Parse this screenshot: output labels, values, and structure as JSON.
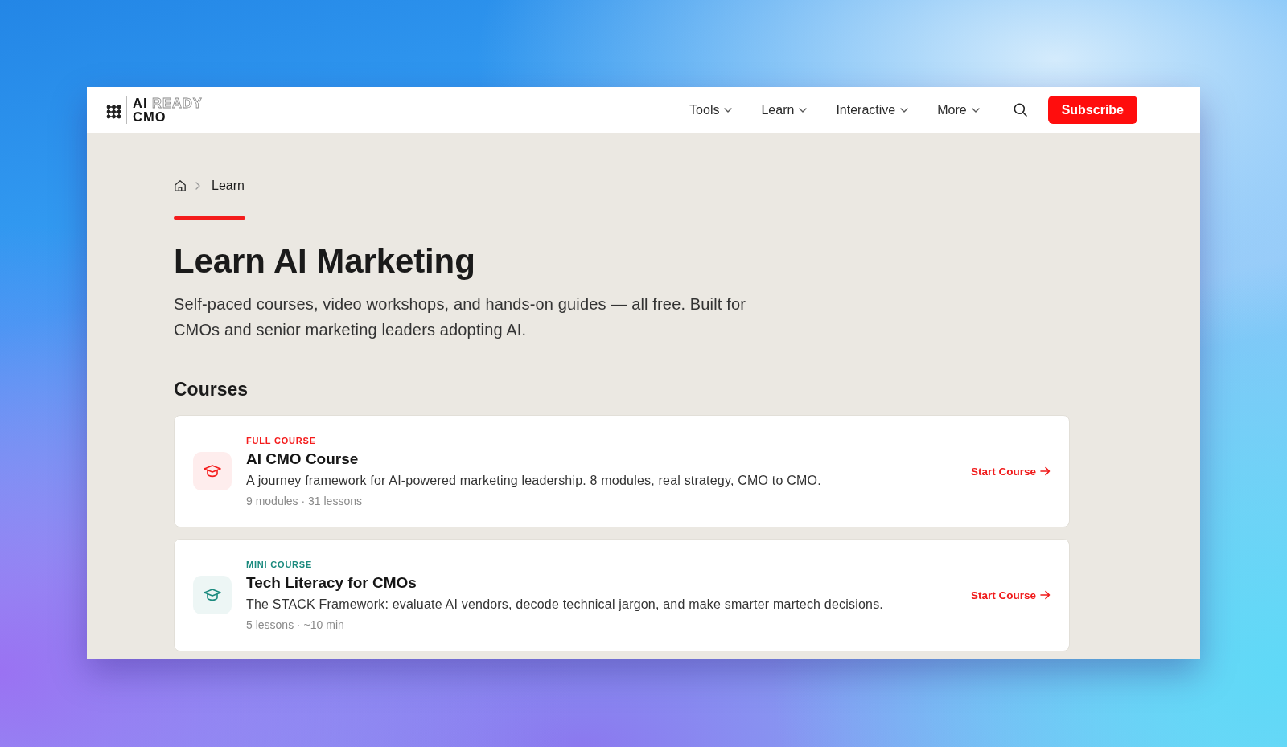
{
  "header": {
    "logo": {
      "word_1": "AI",
      "word_2": "READY",
      "word_3": "CMO"
    },
    "nav": [
      {
        "label": "Tools",
        "dropdown": true
      },
      {
        "label": "Learn",
        "dropdown": true
      },
      {
        "label": "Interactive",
        "dropdown": true
      },
      {
        "label": "More",
        "dropdown": true
      }
    ],
    "subscribe": "Subscribe"
  },
  "breadcrumb": {
    "current": "Learn"
  },
  "hero": {
    "title": "Learn AI Marketing",
    "intro": "Self-paced courses, video workshops, and hands-on guides — all free. Built for CMOs and senior marketing leaders adopting AI."
  },
  "courses": {
    "heading": "Courses",
    "items": [
      {
        "tag": "FULL COURSE",
        "color": "#f41c1c",
        "title": "AI CMO Course",
        "description": "A journey framework for AI-powered marketing leadership. 8 modules, real strategy, CMO to CMO.",
        "meta": "9 modules · 31 lessons",
        "cta": "Start Course"
      },
      {
        "tag": "MINI COURSE",
        "color": "#1b8a7e",
        "title": "Tech Literacy for CMOs",
        "description": "The STACK Framework: evaluate AI vendors, decode technical jargon, and make smarter martech decisions.",
        "meta": "5 lessons · ~10 min",
        "cta": "Start Course"
      }
    ]
  }
}
